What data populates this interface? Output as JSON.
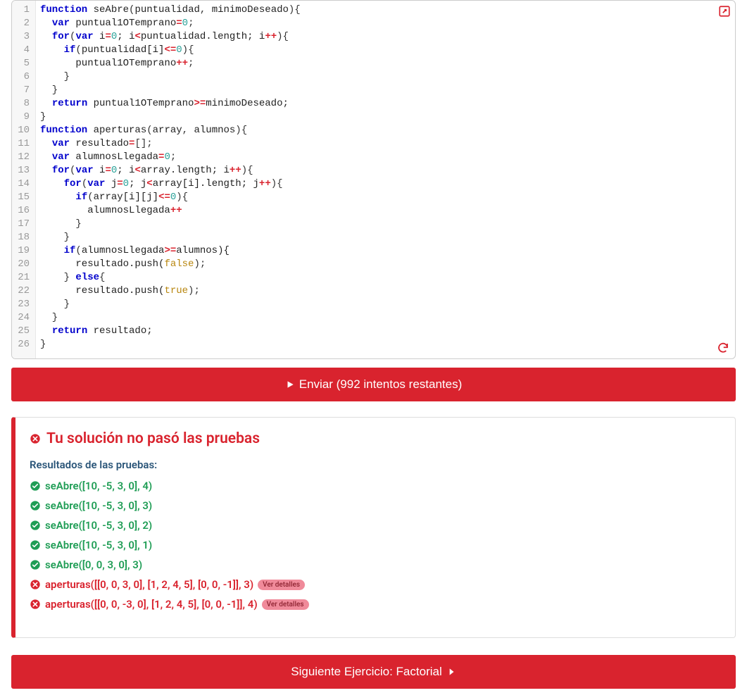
{
  "editor": {
    "gutter": [
      "1",
      "2",
      "3",
      "4",
      "5",
      "6",
      "7",
      "8",
      "9",
      "10",
      "11",
      "12",
      "13",
      "14",
      "15",
      "16",
      "17",
      "18",
      "19",
      "20",
      "21",
      "22",
      "23",
      "24",
      "25",
      "26"
    ],
    "lines": [
      [
        {
          "t": "function ",
          "c": "kw"
        },
        {
          "t": "seAbre",
          "c": "fn"
        },
        {
          "t": "(",
          "c": "paren"
        },
        {
          "t": "puntualidad",
          "c": "id"
        },
        {
          "t": ", ",
          "c": "punct"
        },
        {
          "t": "minimoDeseado",
          "c": "id"
        },
        {
          "t": "){",
          "c": "paren"
        }
      ],
      [
        {
          "t": "  ",
          "c": ""
        },
        {
          "t": "var ",
          "c": "kw"
        },
        {
          "t": "puntual1OTemprano",
          "c": "id"
        },
        {
          "t": "=",
          "c": "op"
        },
        {
          "t": "0",
          "c": "num"
        },
        {
          "t": ";",
          "c": "punct"
        }
      ],
      [
        {
          "t": "  ",
          "c": ""
        },
        {
          "t": "for",
          "c": "kw"
        },
        {
          "t": "(",
          "c": "paren"
        },
        {
          "t": "var ",
          "c": "kw"
        },
        {
          "t": "i",
          "c": "id"
        },
        {
          "t": "=",
          "c": "op"
        },
        {
          "t": "0",
          "c": "num"
        },
        {
          "t": "; i",
          "c": "id"
        },
        {
          "t": "<",
          "c": "op"
        },
        {
          "t": "puntualidad.length; i",
          "c": "id"
        },
        {
          "t": "++",
          "c": "op"
        },
        {
          "t": "){",
          "c": "paren"
        }
      ],
      [
        {
          "t": "    ",
          "c": ""
        },
        {
          "t": "if",
          "c": "kw"
        },
        {
          "t": "(",
          "c": "paren"
        },
        {
          "t": "puntualidad[i]",
          "c": "id"
        },
        {
          "t": "<=",
          "c": "op"
        },
        {
          "t": "0",
          "c": "num"
        },
        {
          "t": "){",
          "c": "paren"
        }
      ],
      [
        {
          "t": "      puntual1OTemprano",
          "c": "id"
        },
        {
          "t": "++",
          "c": "op"
        },
        {
          "t": ";",
          "c": "punct"
        }
      ],
      [
        {
          "t": "    }",
          "c": "paren"
        }
      ],
      [
        {
          "t": "  }",
          "c": "paren"
        }
      ],
      [
        {
          "t": "  ",
          "c": ""
        },
        {
          "t": "return ",
          "c": "kw"
        },
        {
          "t": "puntual1OTemprano",
          "c": "id"
        },
        {
          "t": ">=",
          "c": "op"
        },
        {
          "t": "minimoDeseado;",
          "c": "id"
        }
      ],
      [
        {
          "t": "}",
          "c": "paren"
        }
      ],
      [
        {
          "t": "function ",
          "c": "kw"
        },
        {
          "t": "aperturas",
          "c": "fn"
        },
        {
          "t": "(",
          "c": "paren"
        },
        {
          "t": "array",
          "c": "id"
        },
        {
          "t": ", ",
          "c": "punct"
        },
        {
          "t": "alumnos",
          "c": "id"
        },
        {
          "t": "){",
          "c": "paren"
        }
      ],
      [
        {
          "t": "  ",
          "c": ""
        },
        {
          "t": "var ",
          "c": "kw"
        },
        {
          "t": "resultado",
          "c": "id"
        },
        {
          "t": "=",
          "c": "op"
        },
        {
          "t": "[];",
          "c": "punct"
        }
      ],
      [
        {
          "t": "  ",
          "c": ""
        },
        {
          "t": "var ",
          "c": "kw"
        },
        {
          "t": "alumnosLlegada",
          "c": "id"
        },
        {
          "t": "=",
          "c": "op"
        },
        {
          "t": "0",
          "c": "num"
        },
        {
          "t": ";",
          "c": "punct"
        }
      ],
      [
        {
          "t": "  ",
          "c": ""
        },
        {
          "t": "for",
          "c": "kw"
        },
        {
          "t": "(",
          "c": "paren"
        },
        {
          "t": "var ",
          "c": "kw"
        },
        {
          "t": "i",
          "c": "id"
        },
        {
          "t": "=",
          "c": "op"
        },
        {
          "t": "0",
          "c": "num"
        },
        {
          "t": "; i",
          "c": "id"
        },
        {
          "t": "<",
          "c": "op"
        },
        {
          "t": "array.length; i",
          "c": "id"
        },
        {
          "t": "++",
          "c": "op"
        },
        {
          "t": "){",
          "c": "paren"
        }
      ],
      [
        {
          "t": "    ",
          "c": ""
        },
        {
          "t": "for",
          "c": "kw"
        },
        {
          "t": "(",
          "c": "paren"
        },
        {
          "t": "var ",
          "c": "kw"
        },
        {
          "t": "j",
          "c": "id"
        },
        {
          "t": "=",
          "c": "op"
        },
        {
          "t": "0",
          "c": "num"
        },
        {
          "t": "; j",
          "c": "id"
        },
        {
          "t": "<",
          "c": "op"
        },
        {
          "t": "array[i].length; j",
          "c": "id"
        },
        {
          "t": "++",
          "c": "op"
        },
        {
          "t": "){",
          "c": "paren"
        }
      ],
      [
        {
          "t": "      ",
          "c": ""
        },
        {
          "t": "if",
          "c": "kw"
        },
        {
          "t": "(",
          "c": "paren"
        },
        {
          "t": "array[i][j]",
          "c": "id"
        },
        {
          "t": "<=",
          "c": "op"
        },
        {
          "t": "0",
          "c": "num"
        },
        {
          "t": "){",
          "c": "paren"
        }
      ],
      [
        {
          "t": "        alumnosLlegada",
          "c": "id"
        },
        {
          "t": "++",
          "c": "op"
        }
      ],
      [
        {
          "t": "      }",
          "c": "paren"
        }
      ],
      [
        {
          "t": "    }",
          "c": "paren"
        }
      ],
      [
        {
          "t": "    ",
          "c": ""
        },
        {
          "t": "if",
          "c": "kw"
        },
        {
          "t": "(",
          "c": "paren"
        },
        {
          "t": "alumnosLlegada",
          "c": "id"
        },
        {
          "t": ">=",
          "c": "op"
        },
        {
          "t": "alumnos){",
          "c": "id"
        }
      ],
      [
        {
          "t": "      resultado.push(",
          "c": "id"
        },
        {
          "t": "false",
          "c": "bool"
        },
        {
          "t": ");",
          "c": "punct"
        }
      ],
      [
        {
          "t": "    } ",
          "c": "paren"
        },
        {
          "t": "else",
          "c": "kw"
        },
        {
          "t": "{",
          "c": "paren"
        }
      ],
      [
        {
          "t": "      resultado.push(",
          "c": "id"
        },
        {
          "t": "true",
          "c": "bool"
        },
        {
          "t": ");",
          "c": "punct"
        }
      ],
      [
        {
          "t": "    }",
          "c": "paren"
        }
      ],
      [
        {
          "t": "  }",
          "c": "paren"
        }
      ],
      [
        {
          "t": "  ",
          "c": ""
        },
        {
          "t": "return ",
          "c": "kw"
        },
        {
          "t": "resultado;",
          "c": "id"
        }
      ],
      [
        {
          "t": "}",
          "c": "paren"
        }
      ]
    ]
  },
  "submit": {
    "label": "Enviar (992 intentos restantes)"
  },
  "results": {
    "header": "Tu solución no pasó las pruebas",
    "sub": "Resultados de las pruebas:",
    "tests": [
      {
        "status": "pass",
        "text": "seAbre([10, -5, 3, 0], 4)"
      },
      {
        "status": "pass",
        "text": "seAbre([10, -5, 3, 0], 3)"
      },
      {
        "status": "pass",
        "text": "seAbre([10, -5, 3, 0], 2)"
      },
      {
        "status": "pass",
        "text": "seAbre([10, -5, 3, 0], 1)"
      },
      {
        "status": "pass",
        "text": "seAbre([0, 0, 3, 0], 3)"
      },
      {
        "status": "fail",
        "text": "aperturas([[0, 0, 3, 0], [1, 2, 4, 5], [0, 0, -1]], 3)",
        "details": "Ver detalles"
      },
      {
        "status": "fail",
        "text": "aperturas([[0, 0, -3, 0], [1, 2, 4, 5], [0, 0, -1]], 4)",
        "details": "Ver detalles"
      }
    ]
  },
  "next": {
    "label": "Siguiente Ejercicio: Factorial"
  }
}
